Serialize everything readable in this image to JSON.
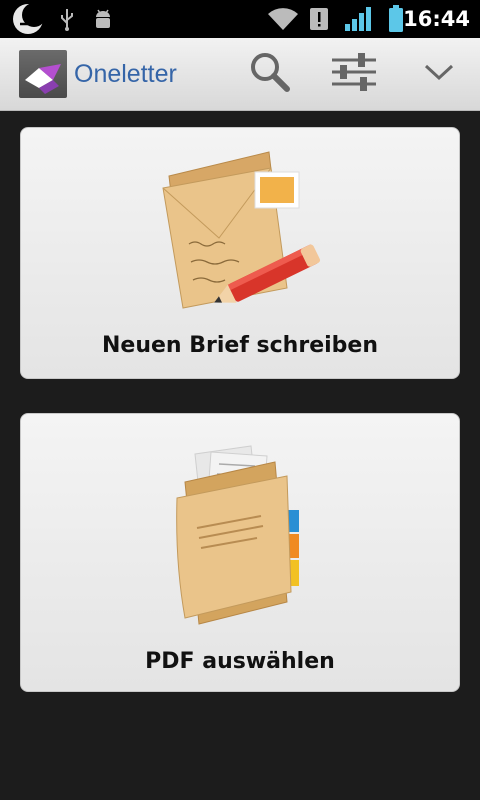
{
  "status_bar": {
    "time": "16:44",
    "icons": [
      "notification-moon-icon",
      "usb-icon",
      "android-debug-icon",
      "wifi-icon",
      "alert-icon",
      "signal-icon",
      "battery-icon"
    ]
  },
  "action_bar": {
    "title": "Oneletter",
    "icons": [
      "app-logo-icon",
      "search-icon",
      "settings-sliders-icon",
      "chevron-down-icon"
    ]
  },
  "cards": [
    {
      "label": "Neuen Brief schreiben",
      "icon": "envelope-pencil-icon"
    },
    {
      "label": "PDF auswählen",
      "icon": "folder-documents-icon"
    }
  ],
  "colors": {
    "title": "#3565a8",
    "background": "#1c1c1c"
  }
}
